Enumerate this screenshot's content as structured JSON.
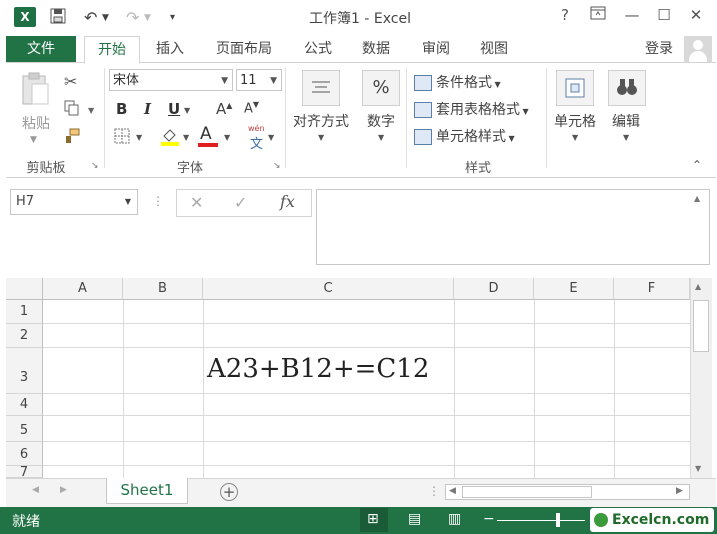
{
  "app": {
    "title": "工作簿1 - Excel",
    "logo_letter": "X",
    "help": "?",
    "colors": {
      "accent": "#217346",
      "status_bg": "#217346",
      "header_bg": "#f3f3f3"
    }
  },
  "tabs": {
    "file": "文件",
    "home": "开始",
    "insert": "插入",
    "page_layout": "页面布局",
    "formulas": "公式",
    "data": "数据",
    "review": "审阅",
    "view": "视图",
    "login": "登录"
  },
  "clipboard": {
    "paste": "粘贴",
    "group": "剪贴板"
  },
  "font": {
    "name": "宋体",
    "size": "11",
    "bold": "B",
    "italic": "I",
    "underline": "U",
    "grow": "A",
    "shrink": "A",
    "color_a": "A",
    "wen": "wén",
    "wen_char": "文",
    "group": "字体"
  },
  "alignment": {
    "label": "对齐方式"
  },
  "number": {
    "label": "数字",
    "icon_text": "%"
  },
  "styles": {
    "conditional": "条件格式",
    "table": "套用表格格式",
    "cell_styles": "单元格样式",
    "group": "样式"
  },
  "cells": {
    "label": "单元格"
  },
  "editing": {
    "label": "编辑"
  },
  "formula_bar": {
    "name_box": "H7",
    "cancel": "✕",
    "enter": "✓",
    "fx": "fx",
    "content": ""
  },
  "sheet": {
    "columns": [
      "A",
      "B",
      "C",
      "D",
      "E",
      "F"
    ],
    "rows": [
      "1",
      "2",
      "3",
      "4",
      "5",
      "6",
      "7"
    ],
    "cell_c3": "A23+B12+=C12",
    "tab": "Sheet1",
    "add": "+"
  },
  "status": {
    "ready": "就绪",
    "watermark": "Excelcn.com"
  }
}
